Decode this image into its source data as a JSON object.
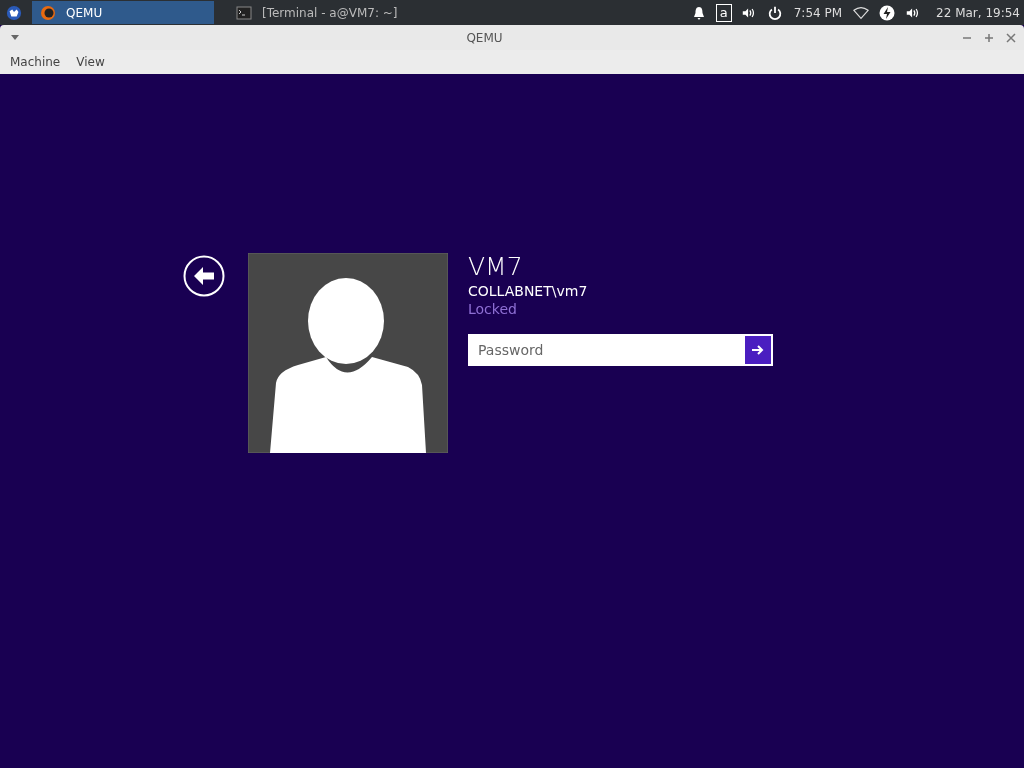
{
  "taskbar": {
    "tasks": [
      {
        "label": "QEMU",
        "selected": true,
        "kind": "qemu"
      },
      {
        "label": "[Terminal - a@VM7: ~]",
        "selected": false,
        "kind": "terminal"
      }
    ],
    "keyboard_layout": "a",
    "clock": "7:54 PM",
    "date_time": "22 Mar, 19:54"
  },
  "window": {
    "title": "QEMU",
    "menu": [
      "Machine",
      "View"
    ]
  },
  "login": {
    "user_name": "VM7",
    "account": "COLLABNET\\vm7",
    "status": "Locked",
    "password": {
      "placeholder": "Password"
    }
  }
}
